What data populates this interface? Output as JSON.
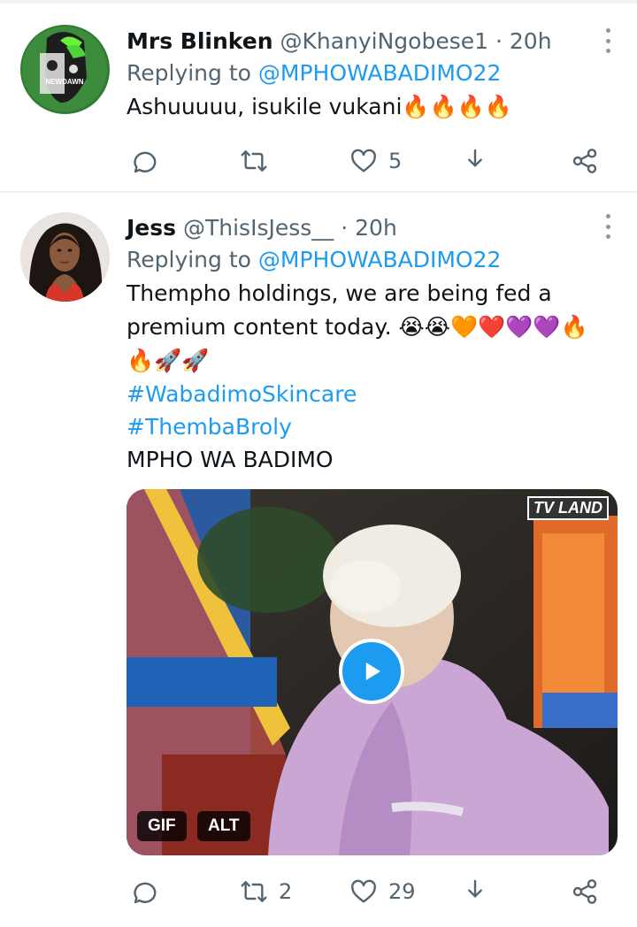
{
  "tweets": [
    {
      "name": "Mrs Blinken",
      "handle": "@KhanyiNgobese1",
      "dot": "·",
      "time": "20h",
      "replying_prefix": "Replying to ",
      "replying_handle": "@MPHOWABADIMO22",
      "text": "Ashuuuuu, isukile vukani",
      "text_emojis": "🔥🔥🔥🔥",
      "avatar_text": "NEWDAWN",
      "actions": {
        "reply_count": "",
        "retweet_count": "",
        "like_count": "5"
      }
    },
    {
      "name": "Jess",
      "handle": "@ThisIsJess__",
      "dot": "·",
      "time": "20h",
      "replying_prefix": "Replying to ",
      "replying_handle": "@MPHOWABADIMO22",
      "text_line1": "Thempho holdings, we are being fed a",
      "text_line2": "premium content today.",
      "text_line2_emojis": "😭😭🧡❤️💜💜🔥",
      "text_line3_emojis": "🔥🚀🚀",
      "hashtag1": "#WabadimoSkincare",
      "hashtag2": "#ThembaBroly",
      "plain_line": "MPHO WA BADIMO",
      "media": {
        "gif_label": "GIF",
        "alt_label": "ALT",
        "watermark": "TV LAND"
      },
      "actions": {
        "reply_count": "",
        "retweet_count": "2",
        "like_count": "29"
      }
    }
  ],
  "colors": {
    "link": "#1d9bf0",
    "secondary": "#536471",
    "divider": "#eff3f4"
  },
  "icons": [
    "reply-icon",
    "retweet-icon",
    "like-icon",
    "share-icon",
    "more-icon",
    "play-icon"
  ]
}
